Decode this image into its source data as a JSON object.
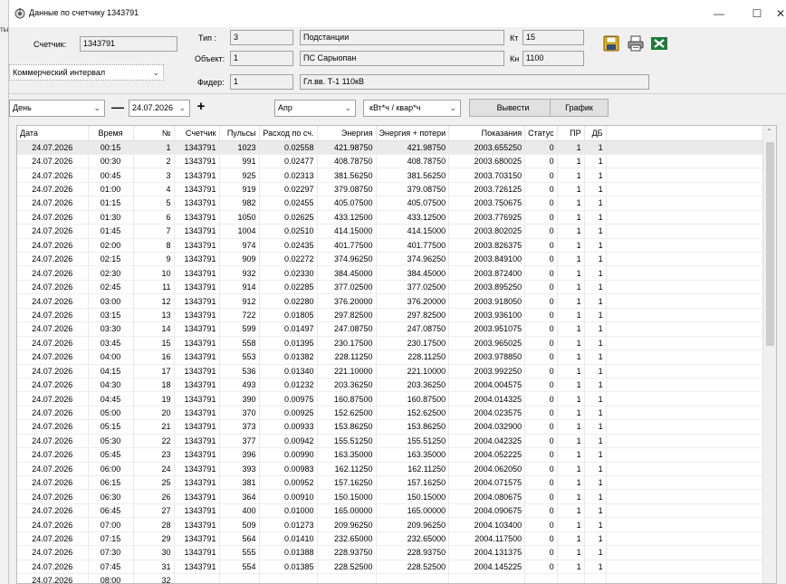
{
  "window": {
    "title": "Данные по счетчику 1343791",
    "min": "—",
    "max": "☐",
    "close": "✕"
  },
  "left_fragment": "ты",
  "meter": {
    "label": "Счетчик:",
    "value": "1343791"
  },
  "type": {
    "label": "Тип :",
    "code": "3",
    "name": "Подстанции"
  },
  "object": {
    "label": "Объект:",
    "code": "1",
    "name": "ПС Сарыопан"
  },
  "feeder": {
    "label": "Фидер:",
    "code": "1",
    "name": "Гл.вв. Т-1 110кВ"
  },
  "kt": {
    "label": "Кт",
    "value": "15"
  },
  "kn": {
    "label": "Кн",
    "value": "1100"
  },
  "interval_select": "Коммерческий интервал",
  "toolbar": {
    "period": "День",
    "date": "24.07.2026",
    "minus": "—",
    "plus": "+",
    "channel": "Апр",
    "units": "кВт*ч  / квар*ч",
    "output_button": "Вывести",
    "chart_button": "График"
  },
  "icons": {
    "save": "save-icon",
    "print": "print-icon",
    "excel": "excel-icon",
    "meter": "meter-icon"
  },
  "colors": {
    "excel": "#1d7a3a",
    "save": "#f0b400",
    "selected_row": "#eaeaea"
  },
  "table": {
    "headers": [
      "Дата",
      "Время",
      "№",
      "Счетчик",
      "Пульсы",
      "Расход по сч.",
      "Энергия",
      "Энергия + потери",
      "Показания",
      "Статус",
      "ПР",
      "ДБ"
    ],
    "rows": [
      [
        "24.07.2026",
        "00:15",
        "1",
        "1343791",
        "1023",
        "0.02558",
        "421.98750",
        "421.98750",
        "2003.655250",
        "0",
        "1",
        "1"
      ],
      [
        "24.07.2026",
        "00:30",
        "2",
        "1343791",
        "991",
        "0.02477",
        "408.78750",
        "408.78750",
        "2003.680025",
        "0",
        "1",
        "1"
      ],
      [
        "24.07.2026",
        "00:45",
        "3",
        "1343791",
        "925",
        "0.02313",
        "381.56250",
        "381.56250",
        "2003.703150",
        "0",
        "1",
        "1"
      ],
      [
        "24.07.2026",
        "01:00",
        "4",
        "1343791",
        "919",
        "0.02297",
        "379.08750",
        "379.08750",
        "2003.726125",
        "0",
        "1",
        "1"
      ],
      [
        "24.07.2026",
        "01:15",
        "5",
        "1343791",
        "982",
        "0.02455",
        "405.07500",
        "405.07500",
        "2003.750675",
        "0",
        "1",
        "1"
      ],
      [
        "24.07.2026",
        "01:30",
        "6",
        "1343791",
        "1050",
        "0.02625",
        "433.12500",
        "433.12500",
        "2003.776925",
        "0",
        "1",
        "1"
      ],
      [
        "24.07.2026",
        "01:45",
        "7",
        "1343791",
        "1004",
        "0.02510",
        "414.15000",
        "414.15000",
        "2003.802025",
        "0",
        "1",
        "1"
      ],
      [
        "24.07.2026",
        "02:00",
        "8",
        "1343791",
        "974",
        "0.02435",
        "401.77500",
        "401.77500",
        "2003.826375",
        "0",
        "1",
        "1"
      ],
      [
        "24.07.2026",
        "02:15",
        "9",
        "1343791",
        "909",
        "0.02272",
        "374.96250",
        "374.96250",
        "2003.849100",
        "0",
        "1",
        "1"
      ],
      [
        "24.07.2026",
        "02:30",
        "10",
        "1343791",
        "932",
        "0.02330",
        "384.45000",
        "384.45000",
        "2003.872400",
        "0",
        "1",
        "1"
      ],
      [
        "24.07.2026",
        "02:45",
        "11",
        "1343791",
        "914",
        "0.02285",
        "377.02500",
        "377.02500",
        "2003.895250",
        "0",
        "1",
        "1"
      ],
      [
        "24.07.2026",
        "03:00",
        "12",
        "1343791",
        "912",
        "0.02280",
        "376.20000",
        "376.20000",
        "2003.918050",
        "0",
        "1",
        "1"
      ],
      [
        "24.07.2026",
        "03:15",
        "13",
        "1343791",
        "722",
        "0.01805",
        "297.82500",
        "297.82500",
        "2003.936100",
        "0",
        "1",
        "1"
      ],
      [
        "24.07.2026",
        "03:30",
        "14",
        "1343791",
        "599",
        "0.01497",
        "247.08750",
        "247.08750",
        "2003.951075",
        "0",
        "1",
        "1"
      ],
      [
        "24.07.2026",
        "03:45",
        "15",
        "1343791",
        "558",
        "0.01395",
        "230.17500",
        "230.17500",
        "2003.965025",
        "0",
        "1",
        "1"
      ],
      [
        "24.07.2026",
        "04:00",
        "16",
        "1343791",
        "553",
        "0.01382",
        "228.11250",
        "228.11250",
        "2003.978850",
        "0",
        "1",
        "1"
      ],
      [
        "24.07.2026",
        "04:15",
        "17",
        "1343791",
        "536",
        "0.01340",
        "221.10000",
        "221.10000",
        "2003.992250",
        "0",
        "1",
        "1"
      ],
      [
        "24.07.2026",
        "04:30",
        "18",
        "1343791",
        "493",
        "0.01232",
        "203.36250",
        "203.36250",
        "2004.004575",
        "0",
        "1",
        "1"
      ],
      [
        "24.07.2026",
        "04:45",
        "19",
        "1343791",
        "390",
        "0.00975",
        "160.87500",
        "160.87500",
        "2004.014325",
        "0",
        "1",
        "1"
      ],
      [
        "24.07.2026",
        "05:00",
        "20",
        "1343791",
        "370",
        "0.00925",
        "152.62500",
        "152.62500",
        "2004.023575",
        "0",
        "1",
        "1"
      ],
      [
        "24.07.2026",
        "05:15",
        "21",
        "1343791",
        "373",
        "0.00933",
        "153.86250",
        "153.86250",
        "2004.032900",
        "0",
        "1",
        "1"
      ],
      [
        "24.07.2026",
        "05:30",
        "22",
        "1343791",
        "377",
        "0.00942",
        "155.51250",
        "155.51250",
        "2004.042325",
        "0",
        "1",
        "1"
      ],
      [
        "24.07.2026",
        "05:45",
        "23",
        "1343791",
        "396",
        "0.00990",
        "163.35000",
        "163.35000",
        "2004.052225",
        "0",
        "1",
        "1"
      ],
      [
        "24.07.2026",
        "06:00",
        "24",
        "1343791",
        "393",
        "0.00983",
        "162.11250",
        "162.11250",
        "2004.062050",
        "0",
        "1",
        "1"
      ],
      [
        "24.07.2026",
        "06:15",
        "25",
        "1343791",
        "381",
        "0.00952",
        "157.16250",
        "157.16250",
        "2004.071575",
        "0",
        "1",
        "1"
      ],
      [
        "24.07.2026",
        "06:30",
        "26",
        "1343791",
        "364",
        "0.00910",
        "150.15000",
        "150.15000",
        "2004.080675",
        "0",
        "1",
        "1"
      ],
      [
        "24.07.2026",
        "06:45",
        "27",
        "1343791",
        "400",
        "0.01000",
        "165.00000",
        "165.00000",
        "2004.090675",
        "0",
        "1",
        "1"
      ],
      [
        "24.07.2026",
        "07:00",
        "28",
        "1343791",
        "509",
        "0.01273",
        "209.96250",
        "209.96250",
        "2004.103400",
        "0",
        "1",
        "1"
      ],
      [
        "24.07.2026",
        "07:15",
        "29",
        "1343791",
        "564",
        "0.01410",
        "232.65000",
        "232.65000",
        "2004.117500",
        "0",
        "1",
        "1"
      ],
      [
        "24.07.2026",
        "07:30",
        "30",
        "1343791",
        "555",
        "0.01388",
        "228.93750",
        "228.93750",
        "2004.131375",
        "0",
        "1",
        "1"
      ],
      [
        "24.07.2026",
        "07:45",
        "31",
        "1343791",
        "554",
        "0.01385",
        "228.52500",
        "228.52500",
        "2004.145225",
        "0",
        "1",
        "1"
      ],
      [
        "24.07.2026",
        "08:00",
        "32",
        "",
        "",
        "",
        "",
        "",
        "",
        "",
        "",
        ""
      ]
    ]
  }
}
